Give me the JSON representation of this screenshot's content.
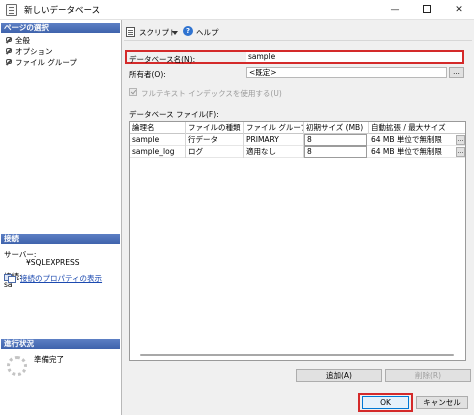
{
  "window": {
    "title": "新しいデータベース",
    "min_glyph": "—",
    "close_glyph": "✕"
  },
  "sidebar": {
    "pages_header": "ページの選択",
    "pages": [
      {
        "label": "全般"
      },
      {
        "label": "オプション"
      },
      {
        "label": "ファイル グループ"
      }
    ],
    "connection_header": "接続",
    "server_label": "サーバー:",
    "server_value": "¥SQLEXPRESS",
    "connection_label": "接続:",
    "connection_value": "sa",
    "view_properties_link": "接続のプロパティの表示",
    "progress_header": "進行状況",
    "progress_status": "準備完了"
  },
  "toolbar": {
    "script_label": "スクリプト",
    "help_label": "ヘルプ",
    "help_glyph": "?"
  },
  "form": {
    "db_name_label": "データベース名(N):",
    "db_name_value": "sample",
    "owner_label": "所有者(O):",
    "owner_value": "<既定>",
    "browse_label": "...",
    "fulltext_label": "フルテキスト インデックスを使用する(U)",
    "fulltext_checked": true,
    "files_label": "データベース ファイル(F):"
  },
  "grid": {
    "columns": [
      "論理名",
      "ファイルの種類",
      "ファイル グループ",
      "初期サイズ (MB)",
      "自動拡張 / 最大サイズ"
    ],
    "rows": [
      {
        "logical_name": "sample",
        "file_type": "行データ",
        "filegroup": "PRIMARY",
        "initial_size": "8",
        "autogrowth": "64 MB 単位で無制限",
        "browse": "..."
      },
      {
        "logical_name": "sample_log",
        "file_type": "ログ",
        "filegroup": "適用なし",
        "initial_size": "8",
        "autogrowth": "64 MB 単位で無制限",
        "browse": "..."
      }
    ]
  },
  "buttons": {
    "add": "追加(A)",
    "remove": "削除(R)",
    "ok": "OK",
    "cancel": "キャンセル"
  },
  "colors": {
    "header_blue": "#4a6db5",
    "highlight_red": "#d42a2a",
    "link_blue": "#1c4ab0",
    "ok_border": "#0078d4"
  }
}
